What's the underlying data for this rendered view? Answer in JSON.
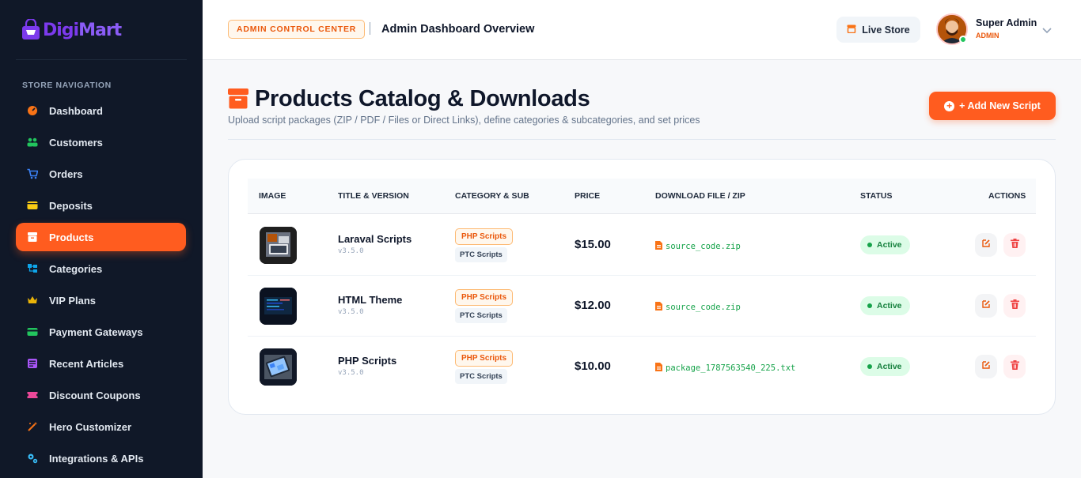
{
  "brand": {
    "name_part1": "Digi",
    "name_part2": "Mart"
  },
  "sidebar": {
    "heading": "STORE NAVIGATION",
    "items": [
      {
        "label": "Dashboard",
        "icon": "gauge-icon",
        "color": "#f97316"
      },
      {
        "label": "Customers",
        "icon": "users-icon",
        "color": "#22c55e"
      },
      {
        "label": "Orders",
        "icon": "cart-icon",
        "color": "#3b82f6"
      },
      {
        "label": "Deposits",
        "icon": "wallet-icon",
        "color": "#facc15"
      },
      {
        "label": "Products",
        "icon": "box-icon",
        "color": "#ffffff",
        "active": true
      },
      {
        "label": "Categories",
        "icon": "sitemap-icon",
        "color": "#0ea5e9"
      },
      {
        "label": "VIP Plans",
        "icon": "crown-icon",
        "color": "#eab308"
      },
      {
        "label": "Payment Gateways",
        "icon": "card-icon",
        "color": "#22c55e"
      },
      {
        "label": "Recent Articles",
        "icon": "newspaper-icon",
        "color": "#a855f7"
      },
      {
        "label": "Discount Coupons",
        "icon": "ticket-icon",
        "color": "#ec4899"
      },
      {
        "label": "Hero Customizer",
        "icon": "wand-icon",
        "color": "#f97316"
      },
      {
        "label": "Integrations & APIs",
        "icon": "gears-icon",
        "color": "#38bdf8"
      }
    ]
  },
  "header": {
    "badge": "ADMIN CONTROL CENTER",
    "title": "Admin Dashboard Overview",
    "live_store": "Live Store",
    "user_name": "Super Admin",
    "user_role": "ADMIN"
  },
  "page": {
    "title": "Products Catalog & Downloads",
    "subtitle": "Upload script packages (ZIP / PDF / Files or Direct Links), define categories & subcategories, and set prices",
    "add_button": "+ Add New Script"
  },
  "table": {
    "headers": [
      "IMAGE",
      "TITLE & VERSION",
      "CATEGORY & SUB",
      "PRICE",
      "DOWNLOAD FILE / ZIP",
      "STATUS",
      "ACTIONS"
    ],
    "rows": [
      {
        "title": "Laraval Scripts",
        "version": "v3.5.0",
        "category": "PHP Scripts",
        "sub": "PTC Scripts",
        "price": "$15.00",
        "file": "source_code.zip",
        "status": "Active"
      },
      {
        "title": "HTML Theme",
        "version": "v3.5.0",
        "category": "PHP Scripts",
        "sub": "PTC Scripts",
        "price": "$12.00",
        "file": "source_code.zip",
        "status": "Active"
      },
      {
        "title": "PHP Scripts",
        "version": "v3.5.0",
        "category": "PHP Scripts",
        "sub": "PTC Scripts",
        "price": "$10.00",
        "file": "package_1787563540_225.txt",
        "status": "Active"
      }
    ]
  },
  "colors": {
    "accent": "#ff5c1f",
    "sidebar_bg": "#101828",
    "active_status": "#16a34a"
  }
}
